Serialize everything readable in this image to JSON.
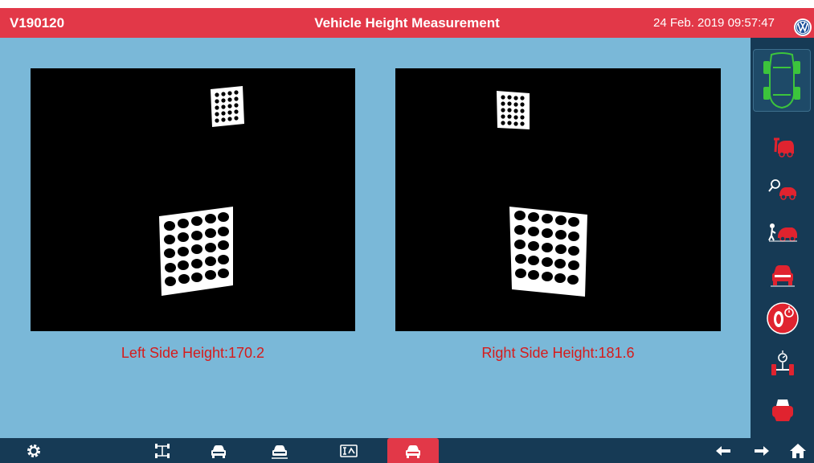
{
  "header": {
    "vehicle_code": "V190120",
    "title": "Vehicle Height Measurement",
    "datetime": "24 Feb. 2019 09:57:47",
    "brand_icon": "vw-logo-icon"
  },
  "measurements": {
    "left_label": "Left Side Height:",
    "left_value": "170.2",
    "right_label": "Right Side Height:",
    "right_value": "181.6"
  },
  "sidebar": {
    "items": [
      {
        "name": "vehicle-overview-icon",
        "active": true
      },
      {
        "name": "vehicle-adjust-icon"
      },
      {
        "name": "vehicle-search-icon"
      },
      {
        "name": "vehicle-service-icon"
      },
      {
        "name": "vehicle-front-icon"
      },
      {
        "name": "wheel-runout-icon",
        "highlight": true
      },
      {
        "name": "axle-measure-icon"
      },
      {
        "name": "print-icon"
      }
    ]
  },
  "footer": {
    "items": [
      {
        "name": "settings-icon"
      },
      {
        "name": "alignment-icon"
      },
      {
        "name": "car-front-icon"
      },
      {
        "name": "car-front-alt-icon"
      },
      {
        "name": "calibration-icon"
      },
      {
        "name": "vehicle-height-icon",
        "active": true
      },
      {
        "name": "back-arrow-icon"
      },
      {
        "name": "forward-arrow-icon"
      },
      {
        "name": "home-icon"
      }
    ]
  },
  "colors": {
    "accent_red": "#e23848",
    "panel_blue": "#7ab8d8",
    "bar_navy": "#163a55",
    "reading_red": "#d61b1b"
  }
}
